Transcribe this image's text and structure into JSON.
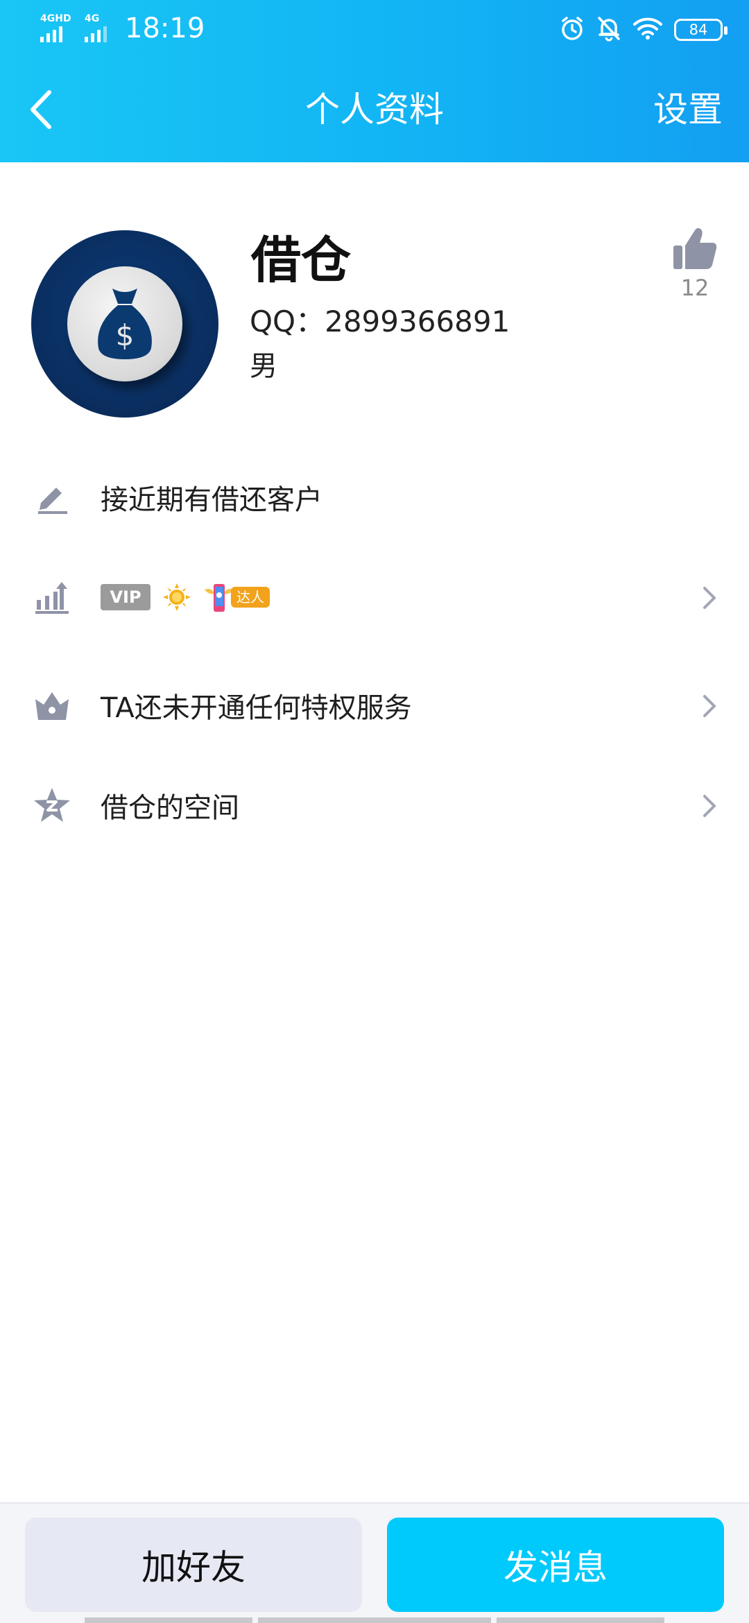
{
  "status_bar": {
    "sim1_label": "4GHD",
    "sim2_label": "4G",
    "time": "18:19",
    "battery": "84",
    "icons": [
      "alarm-icon",
      "bell-off-icon",
      "wifi-icon",
      "battery-icon"
    ]
  },
  "nav": {
    "title": "个人资料",
    "right_action": "设置",
    "back_icon": "chevron-left-icon"
  },
  "profile": {
    "nickname": "借仓",
    "qq": "QQ：2899366891",
    "gender": "男",
    "likes": "12",
    "avatar_icon": "money-bag-icon"
  },
  "rows": {
    "signature": {
      "icon": "pencil-icon",
      "text": "接近期有借还客户"
    },
    "level": {
      "icon": "level-up-icon",
      "vip_label": "VIP",
      "expert_label": "达人"
    },
    "privilege": {
      "icon": "crown-icon",
      "text": "TA还未开通任何特权服务"
    },
    "space": {
      "icon": "star-icon",
      "text": "借仓的空间"
    }
  },
  "actions": {
    "add_friend": "加好友",
    "send_message": "发消息"
  },
  "colors": {
    "header_start": "#19c6f5",
    "header_end": "#139ff2",
    "primary_button": "#00cafb",
    "secondary_button": "#e6e9f3",
    "icon_gray": "#8e93a6"
  }
}
